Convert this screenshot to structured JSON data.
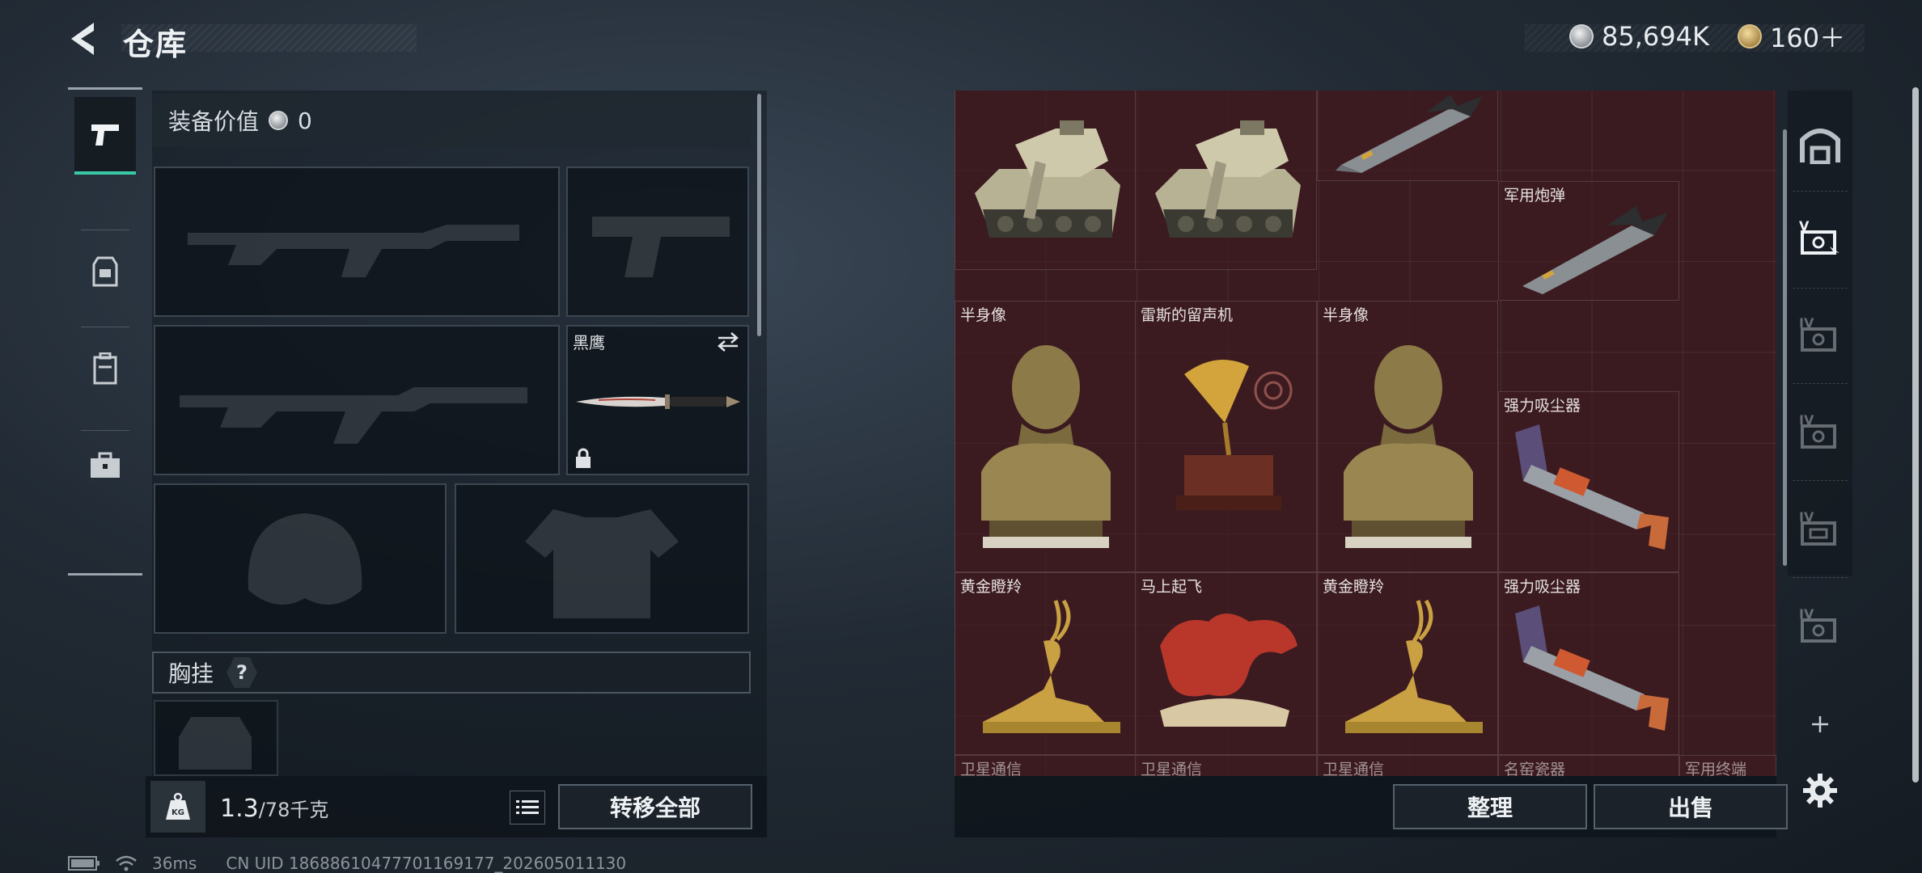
{
  "header": {
    "title": "仓库"
  },
  "currency": [
    {
      "icon": "silver-coin-icon",
      "value": "85,694K"
    },
    {
      "icon": "gold-coin-icon",
      "value": "160＋"
    }
  ],
  "rail": [
    {
      "name": "weapon",
      "icon": "pistol-icon",
      "active": true
    },
    {
      "name": "armor",
      "icon": "vest-icon"
    },
    {
      "name": "backpack",
      "icon": "backpack-icon"
    },
    {
      "name": "case",
      "icon": "toolbox-icon"
    }
  ],
  "equipment": {
    "value_label": "装备价值",
    "value": "0",
    "melee_label": "黑鹰",
    "chest_label": "胸挂",
    "chest_help": "?"
  },
  "weight": {
    "current": "1.3",
    "max": "/78千克",
    "icon": "kg-weight-icon"
  },
  "buttons": {
    "transfer_all": "转移全部",
    "sort": "整理",
    "sell": "出售"
  },
  "status": {
    "ping": "36ms",
    "uid": "CN UID 18688610477701169177_202605011130"
  },
  "inventory": {
    "items": [
      {
        "id": "tank-1",
        "name": ""
      },
      {
        "id": "tank-2",
        "name": ""
      },
      {
        "id": "missile-top",
        "name": ""
      },
      {
        "id": "shell",
        "name": "军用炮弹"
      },
      {
        "id": "bust-1",
        "name": "半身像"
      },
      {
        "id": "gramophone",
        "name": "雷斯的留声机"
      },
      {
        "id": "bust-2",
        "name": "半身像"
      },
      {
        "id": "vacuum-1",
        "name": "强力吸尘器"
      },
      {
        "id": "deer-1",
        "name": "黄金瞪羚"
      },
      {
        "id": "horse",
        "name": "马上起飞"
      },
      {
        "id": "deer-2",
        "name": "黄金瞪羚"
      },
      {
        "id": "vacuum-2",
        "name": "强力吸尘器"
      },
      {
        "id": "sat-1",
        "name": "卫星通信"
      },
      {
        "id": "sat-2",
        "name": "卫星通信"
      },
      {
        "id": "sat-3",
        "name": "卫星通信"
      },
      {
        "id": "porcelain",
        "name": "名窑瓷器"
      },
      {
        "id": "military-terminal",
        "name": "军用终端"
      }
    ]
  },
  "right_rail": [
    {
      "icon": "storage-home-icon"
    },
    {
      "icon": "storage-v-icon",
      "label": "V"
    },
    {
      "icon": "storage-iv-icon",
      "label": "IV"
    },
    {
      "icon": "storage-iv-icon",
      "label": "IV"
    },
    {
      "icon": "storage-iv-icon",
      "label": "IV"
    },
    {
      "icon": "storage-iv-icon",
      "label": "IV"
    },
    {
      "icon": "plus-icon"
    },
    {
      "icon": "gear-icon"
    }
  ]
}
